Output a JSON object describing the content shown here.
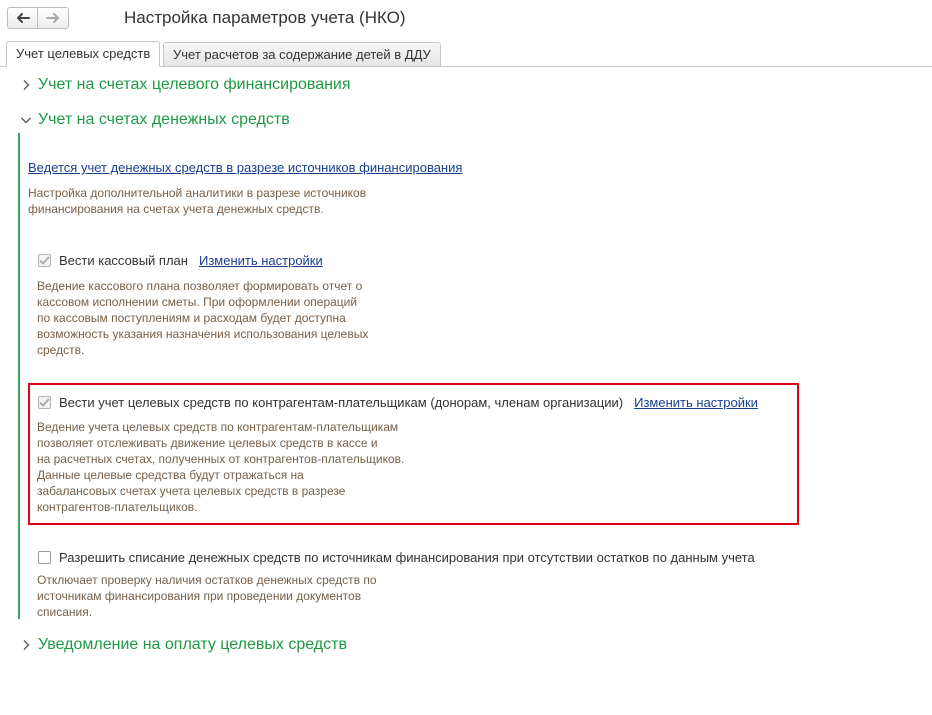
{
  "header": {
    "title": "Настройка параметров учета (НКО)"
  },
  "tabs": [
    {
      "label": "Учет целевых средств",
      "active": true
    },
    {
      "label": "Учет расчетов за содержание детей в ДДУ",
      "active": false
    }
  ],
  "sections": [
    {
      "title": "Учет на счетах целевого финансирования",
      "expanded": false
    },
    {
      "title": "Учет на счетах денежных средств",
      "expanded": true
    },
    {
      "title": "Уведомление на оплату целевых средств",
      "expanded": false
    }
  ],
  "cash": {
    "main_link": "Ведется учет денежных средств в разрезе источников финансирования",
    "main_desc": [
      "Настройка дополнительной аналитики в разрезе источников",
      "финансирования на счетах учета денежных средств."
    ],
    "options": [
      {
        "label": "Вести кассовый план",
        "checked": true,
        "link": "Изменить настройки",
        "desc": [
          "Ведение кассового плана позволяет формировать отчет о",
          "кассовом исполнении сметы. При оформлении операций",
          "по кассовым поступлениям и расходам будет доступна",
          "возможность указания назначения использования целевых",
          "средств."
        ]
      },
      {
        "label": "Вести учет целевых средств по контрагентам-плательщикам (донорам, членам организации)",
        "checked": true,
        "link": "Изменить настройки",
        "desc": [
          "Ведение учета целевых средств по контрагентам-плательщикам",
          "позволяет отслеживать движение целевых средств в кассе и",
          "на расчетных счетах, полученных от контрагентов-плательщиков.",
          "Данные целевые средства будут отражаться на",
          "забалансовых счетах учета целевых средств в разрезе",
          "контрагентов-плательщиков."
        ]
      },
      {
        "label": "Разрешить списание денежных средств по источникам финансирования при отсутствии остатков по данным учета",
        "checked": false,
        "desc": [
          "Отключает проверку наличия остатков денежных средств по",
          "источникам финансирования при проведении документов",
          "списания."
        ]
      }
    ]
  },
  "colors": {
    "section_title": "#1e9a45",
    "link": "#1a3f8f",
    "description": "#77604a",
    "highlight": "#e0001b"
  },
  "icons": {
    "back": "arrow-left-icon",
    "forward": "arrow-right-icon",
    "collapsed": "chevron-right-icon",
    "expanded": "chevron-down-icon",
    "checked": "checkmark-icon"
  }
}
